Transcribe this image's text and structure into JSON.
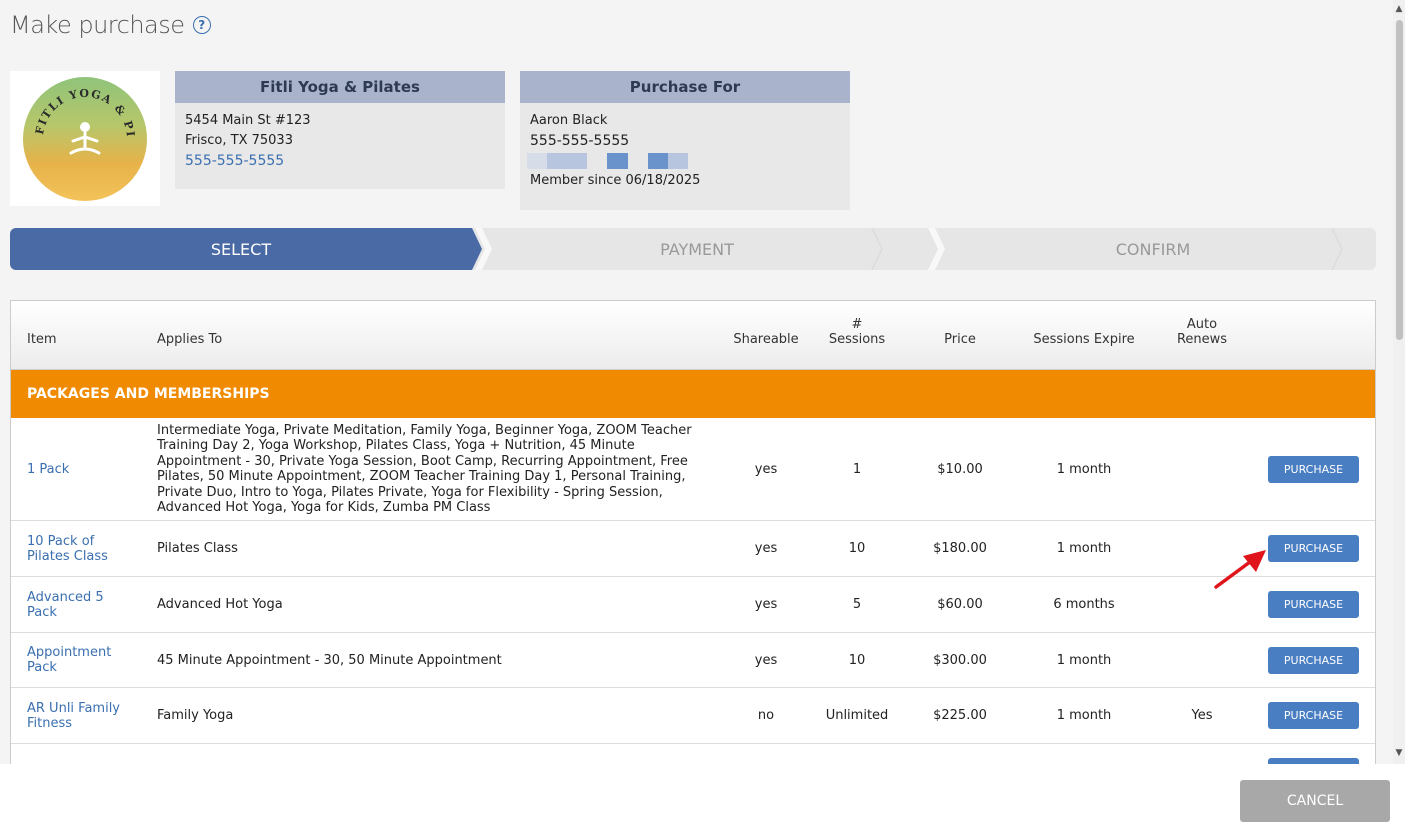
{
  "page": {
    "title": "Make purchase"
  },
  "studio": {
    "name": "Fitli Yoga & Pilates",
    "address1": "5454 Main St #123",
    "address2": "Frisco, TX 75033",
    "phone": "555-555-5555",
    "logo_text": "FITLI YOGA & PILATES"
  },
  "purchase_for": {
    "heading": "Purchase For",
    "name": "Aaron Black",
    "phone": "555-555-5555",
    "member_since": "Member since 06/18/2025"
  },
  "steps": [
    {
      "label": "SELECT",
      "active": true
    },
    {
      "label": "PAYMENT",
      "active": false
    },
    {
      "label": "CONFIRM",
      "active": false
    }
  ],
  "table": {
    "headers": {
      "item": "Item",
      "applies_to": "Applies To",
      "shareable": "Shareable",
      "sessions_line1": "#",
      "sessions_line2": "Sessions",
      "price": "Price",
      "expire": "Sessions Expire",
      "renews_line1": "Auto",
      "renews_line2": "Renews"
    },
    "section_title": "PACKAGES AND MEMBERSHIPS",
    "button_label": "PURCHASE",
    "rows": [
      {
        "item": "1 Pack",
        "applies": "Intermediate Yoga, Private Meditation, Family Yoga, Beginner Yoga, ZOOM Teacher Training Day 2, Yoga Workshop, Pilates Class, Yoga + Nutrition, 45 Minute Appointment - 30, Private Yoga Session, Boot Camp, Recurring Appointment, Free Pilates, 50 Minute Appointment, ZOOM Teacher Training Day 1, Personal Training, Private Duo, Intro to Yoga, Pilates Private, Yoga for Flexibility - Spring Session, Advanced Hot Yoga, Yoga for Kids, Zumba PM Class",
        "shareable": "yes",
        "sessions": "1",
        "price": "$10.00",
        "expire": "1 month",
        "renews": ""
      },
      {
        "item": "10 Pack of Pilates Class",
        "applies": "Pilates Class",
        "shareable": "yes",
        "sessions": "10",
        "price": "$180.00",
        "expire": "1 month",
        "renews": ""
      },
      {
        "item": "Advanced 5 Pack",
        "applies": "Advanced Hot Yoga",
        "shareable": "yes",
        "sessions": "5",
        "price": "$60.00",
        "expire": "6 months",
        "renews": ""
      },
      {
        "item": "Appointment Pack",
        "applies": "45 Minute Appointment - 30, 50 Minute Appointment",
        "shareable": "yes",
        "sessions": "10",
        "price": "$300.00",
        "expire": "1 month",
        "renews": ""
      },
      {
        "item": "AR Unli Family Fitness",
        "applies": "Family Yoga",
        "shareable": "no",
        "sessions": "Unlimited",
        "price": "$225.00",
        "expire": "1 month",
        "renews": "Yes"
      }
    ]
  },
  "footer": {
    "cancel_label": "CANCEL"
  },
  "colors": {
    "accent": "#4a6aa5",
    "section": "#f08a00",
    "button": "#4a7ec2",
    "link": "#3a6fb0"
  }
}
